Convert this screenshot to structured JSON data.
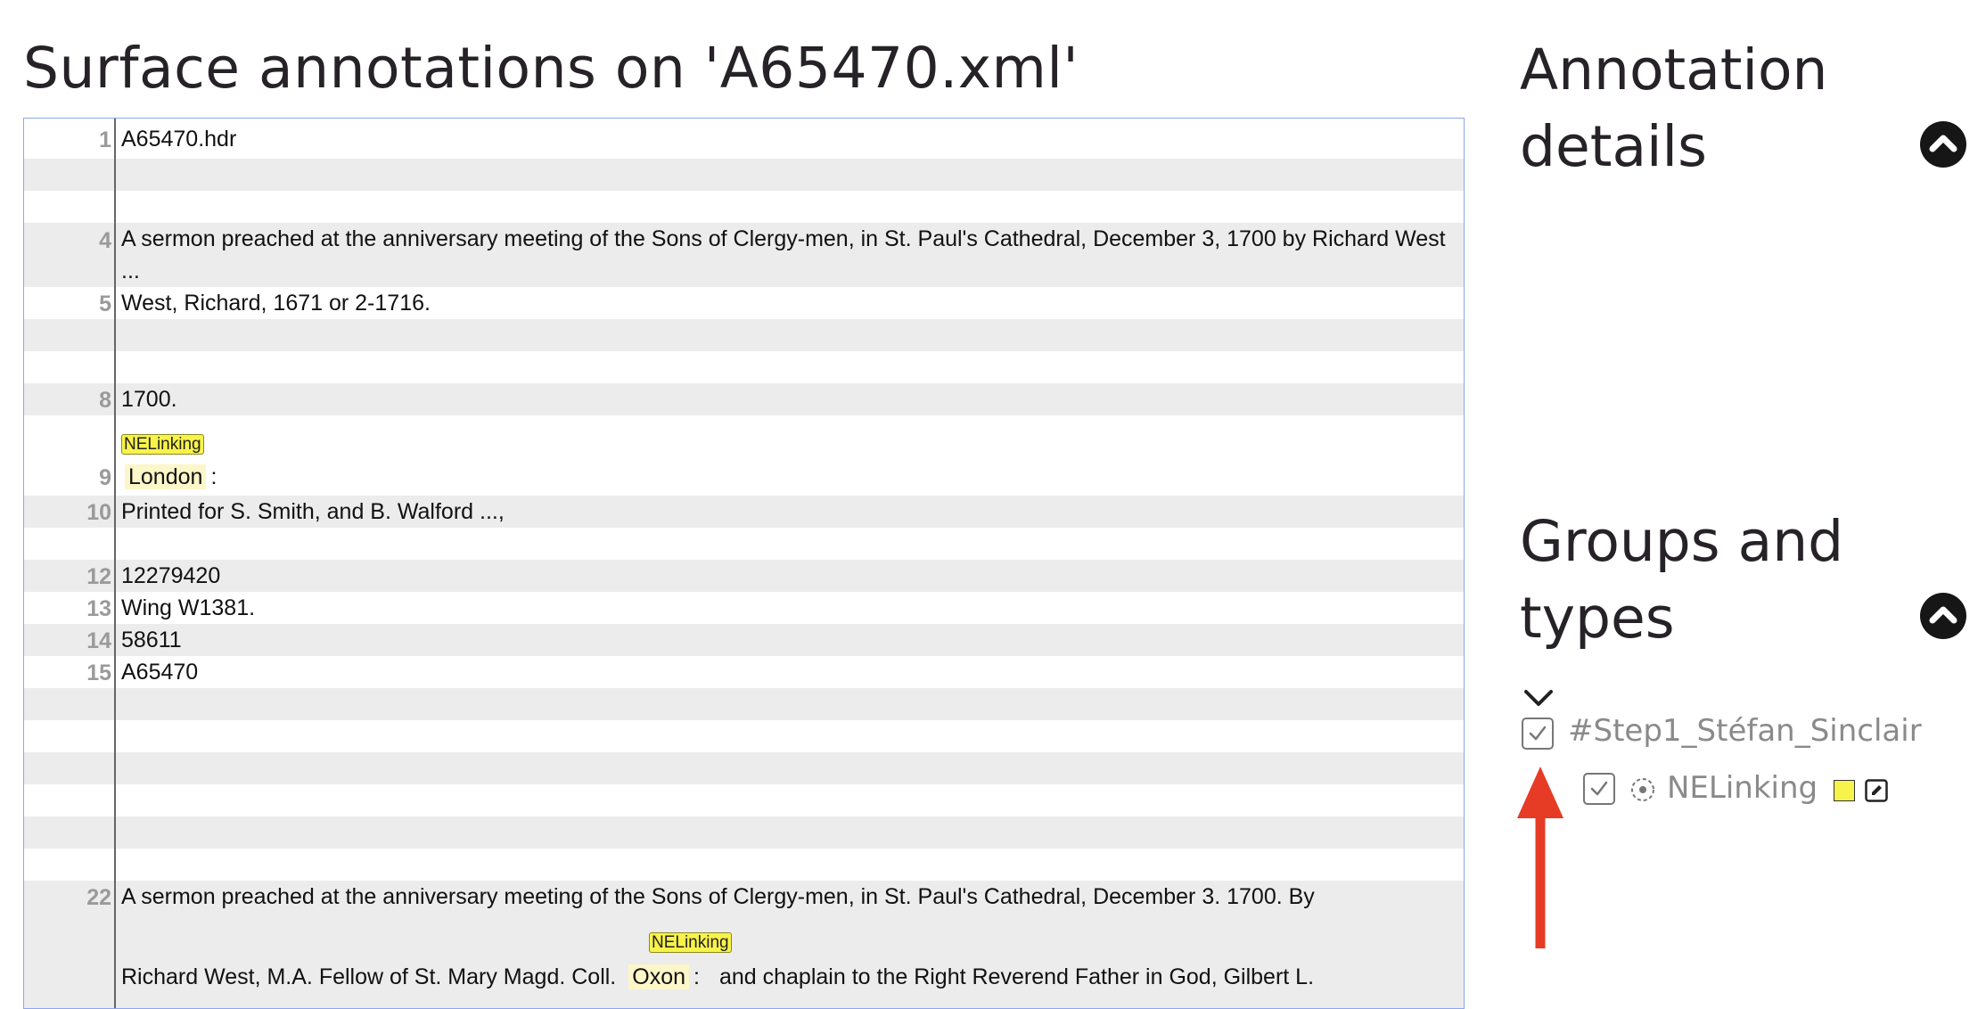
{
  "page_title": "Surface annotations on 'A65470.xml'",
  "lines": [
    {
      "no": "1",
      "text": "A65470.hdr"
    },
    {
      "no": "",
      "text": ""
    },
    {
      "no": "",
      "text": ""
    },
    {
      "no": "4",
      "text": "A sermon preached at the anniversary meeting of the Sons of Clergy-men, in St. Paul's Cathedral, December 3, 1700 by Richard West ..."
    },
    {
      "no": "5",
      "text": "West, Richard, 1671 or 2-1716."
    },
    {
      "no": "",
      "text": ""
    },
    {
      "no": "",
      "text": ""
    },
    {
      "no": "8",
      "text": "1700."
    },
    {
      "no": "9",
      "annotated": "London",
      "tag": "NELinking",
      "after": ":"
    },
    {
      "no": "10",
      "text": "Printed for S. Smith, and B. Walford ...,"
    },
    {
      "no": "",
      "text": ""
    },
    {
      "no": "12",
      "text": "12279420"
    },
    {
      "no": "13",
      "text": "Wing W1381."
    },
    {
      "no": "14",
      "text": "58611"
    },
    {
      "no": "15",
      "text": "A65470"
    },
    {
      "no": "",
      "text": ""
    },
    {
      "no": "",
      "text": ""
    },
    {
      "no": "",
      "text": ""
    },
    {
      "no": "",
      "text": ""
    },
    {
      "no": "",
      "text": ""
    },
    {
      "no": "",
      "text": ""
    },
    {
      "no": "22",
      "text": "A sermon preached at the anniversary meeting of the Sons of Clergy-men, in St. Paul's Cathedral, December 3. 1700. By",
      "cont_before": "Richard West, M.A. Fellow of St. Mary Magd. Coll.",
      "cont_annotated": "Oxon",
      "cont_tag": "NELinking",
      "cont_after": ":",
      "cont_rest": "and chaplain to the Right Reverend Father in God, Gilbert L."
    }
  ],
  "annotation_details": {
    "heading": "Annotation details"
  },
  "groups_and_types": {
    "heading": "Groups and types",
    "group": {
      "label": "#Step1_Stéfan_Sinclair",
      "checked": true
    },
    "type": {
      "label": "NELinking",
      "checked": true,
      "color": "#f8f34a"
    }
  },
  "colors": {
    "accent_border": "#8aa7f0",
    "tag_yellow": "#f8f34a",
    "highlight": "#fcf6c9",
    "arrow_red": "#e63b25",
    "shaded_row": "#ececec"
  },
  "icons": [
    "chevron-up-icon",
    "chevron-down-icon",
    "checkbox-checked-icon",
    "spinner-icon",
    "edit-icon",
    "arrow-up-icon"
  ]
}
